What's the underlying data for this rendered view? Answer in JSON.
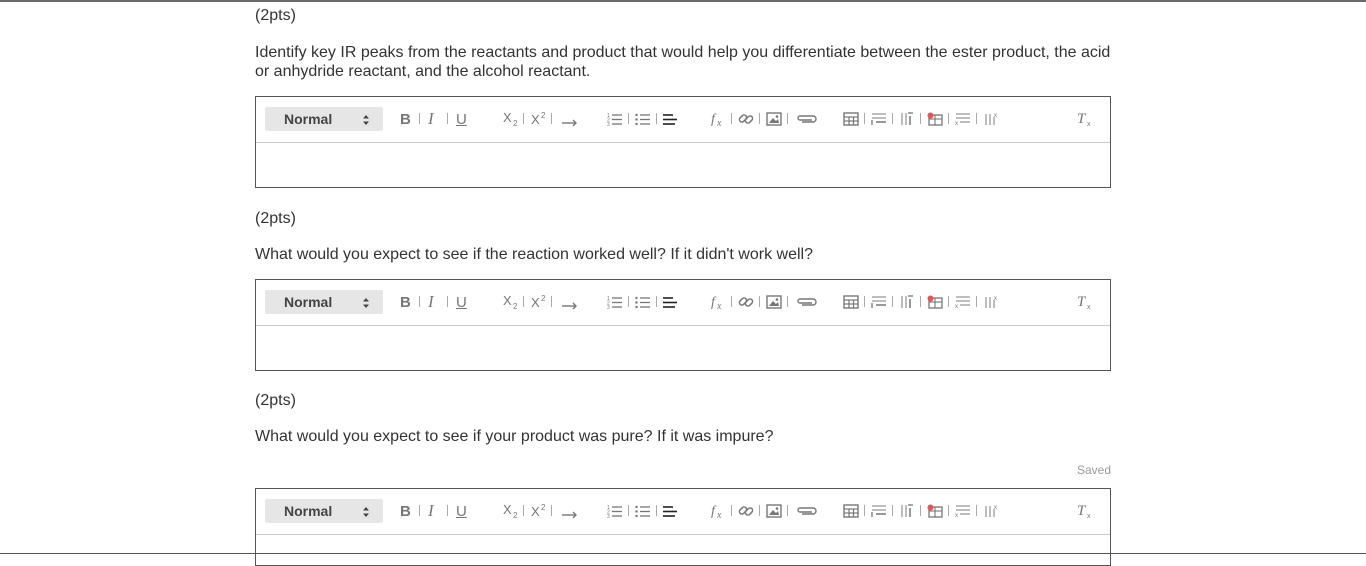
{
  "questions": [
    {
      "points": "(2pts)",
      "prompt": "Identify key IR peaks from the reactants and product that would help you differentiate between the ester product, the acid or anhydride reactant, and the alcohol reactant.",
      "format_value": "Normal"
    },
    {
      "points": "(2pts)",
      "prompt": "What would you expect to see if the reaction worked well? If it didn't work well?",
      "format_value": "Normal"
    },
    {
      "points": "(2pts)",
      "prompt": "What would you expect to see if your product was pure? If it was impure?",
      "format_value": "Normal",
      "status": "Saved"
    }
  ],
  "toolbar_icons": [
    "bold-icon",
    "italic-icon",
    "underline-icon",
    "subscript-icon",
    "superscript-icon",
    "arrow-icon",
    "ordered-list-icon",
    "bullet-list-icon",
    "align-left-icon",
    "formula-icon",
    "link-icon",
    "image-icon",
    "attachment-icon",
    "table-icon",
    "insert-row-icon",
    "insert-column-icon",
    "delete-table-icon",
    "delete-row-icon",
    "delete-column-icon",
    "clear-format-icon"
  ]
}
